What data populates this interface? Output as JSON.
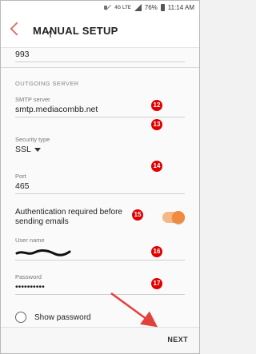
{
  "status_bar": {
    "network": "4G LTE",
    "battery": "76%",
    "time": "11:14 AM"
  },
  "header": {
    "title": "MANUAL SETUP"
  },
  "fields": {
    "previous_port_value": "993",
    "outgoing_section": "OUTGOING SERVER",
    "smtp_label": "SMTP server",
    "smtp_value": "smtp.mediacombb.net",
    "security_label": "Security type",
    "security_value": "SSL",
    "port_label": "Port",
    "port_value": "465",
    "auth_text": "Authentication required before sending emails",
    "auth_enabled": true,
    "username_label": "User name",
    "password_label": "Password",
    "password_value": "••••••••••",
    "show_password_label": "Show password",
    "show_password_checked": false
  },
  "annotations": {
    "badges": [
      "12",
      "13",
      "14",
      "15",
      "16",
      "17"
    ],
    "color": "#e10000"
  },
  "footer": {
    "next_label": "NEXT"
  },
  "colors": {
    "accent": "#f08a3c",
    "back_arrow": "#d5776a"
  }
}
